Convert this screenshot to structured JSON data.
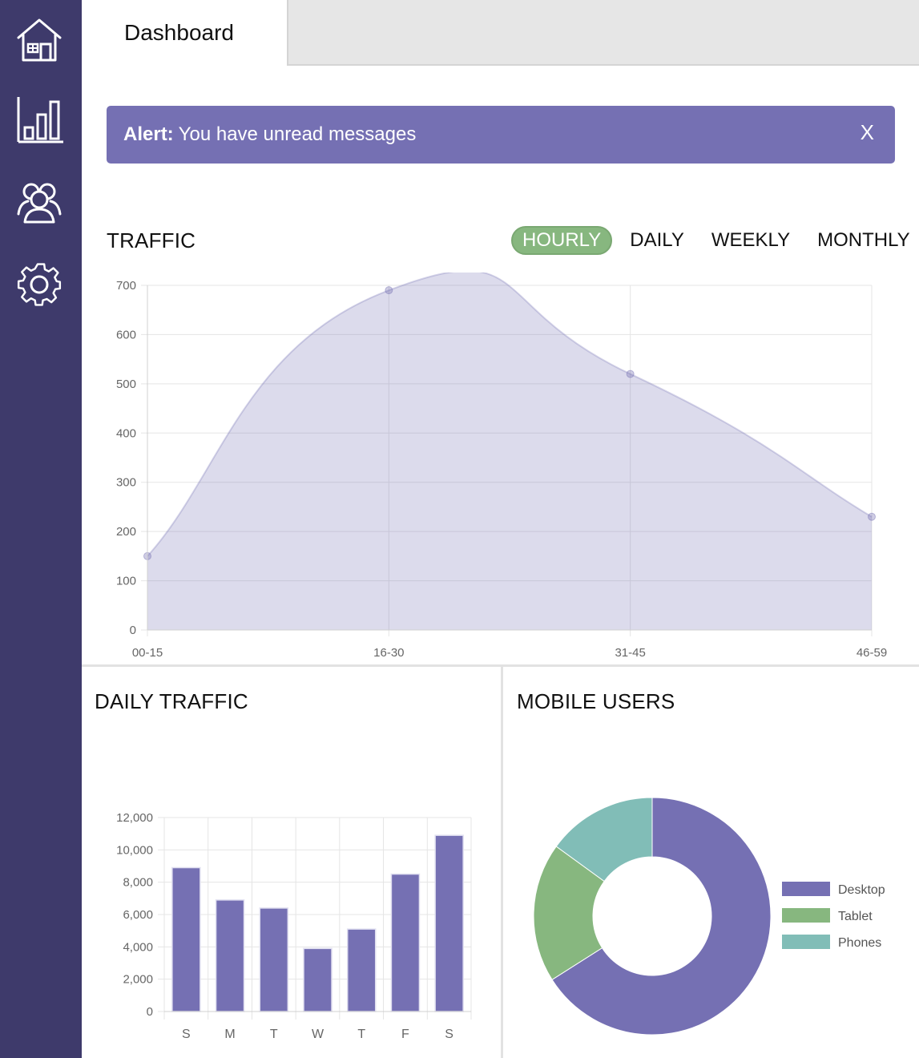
{
  "nav": {
    "items": [
      {
        "icon": "home-icon"
      },
      {
        "icon": "bar-chart-icon"
      },
      {
        "icon": "users-icon"
      },
      {
        "icon": "gear-icon"
      }
    ]
  },
  "header": {
    "tab_label": "Dashboard"
  },
  "alert": {
    "label": "Alert:",
    "message": "You have unread messages",
    "close": "X"
  },
  "traffic": {
    "title": "TRAFFIC",
    "ranges": [
      "HOURLY",
      "DAILY",
      "WEEKLY",
      "MONTHLY"
    ],
    "active_range": "HOURLY"
  },
  "daily_traffic": {
    "title": "DAILY TRAFFIC"
  },
  "mobile_users": {
    "title": "MOBILE USERS"
  },
  "colors": {
    "sidebar": "#3e3a6b",
    "accent": "#7570b3",
    "green": "#87b77f",
    "teal": "#81bdb7"
  },
  "chart_data": [
    {
      "type": "area",
      "categories": [
        "00-15",
        "16-30",
        "31-45",
        "46-59"
      ],
      "values": [
        150,
        690,
        520,
        230
      ],
      "ylim": [
        0,
        700
      ],
      "yticks": [
        0,
        100,
        200,
        300,
        400,
        500,
        600,
        700
      ],
      "grid": true
    },
    {
      "type": "bar",
      "categories": [
        "S",
        "M",
        "T",
        "W",
        "T",
        "F",
        "S"
      ],
      "values": [
        8900,
        6900,
        6400,
        3900,
        5100,
        8500,
        10900
      ],
      "ylim": [
        0,
        12000
      ],
      "yticks": [
        "0",
        "2,000",
        "4,000",
        "6,000",
        "8,000",
        "10,000",
        "12,000"
      ],
      "grid": true
    },
    {
      "type": "pie",
      "categories": [
        "Desktop",
        "Tablet",
        "Phones"
      ],
      "values": [
        66,
        19,
        15
      ],
      "colors": [
        "#7570b3",
        "#87b77f",
        "#81bdb7"
      ],
      "donut": true,
      "legend": "right"
    }
  ]
}
